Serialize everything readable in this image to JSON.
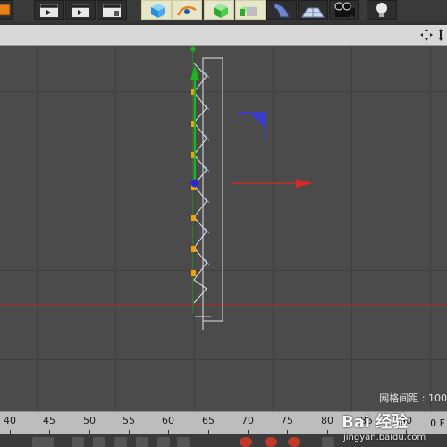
{
  "toolbar": {
    "buttons": [
      {
        "name": "cube-tool-icon",
        "active": false
      },
      {
        "name": "render-view-button",
        "active": false
      },
      {
        "name": "render-active-button",
        "active": false
      },
      {
        "name": "render-settings-button",
        "active": false
      },
      {
        "name": "cube-primitive-button",
        "active": true
      },
      {
        "name": "pen-spline-button",
        "active": true
      },
      {
        "name": "subdivision-button",
        "active": true
      },
      {
        "name": "array-generator-button",
        "active": true
      },
      {
        "name": "deformer-button",
        "active": false
      },
      {
        "name": "floor-plane-button",
        "active": false
      },
      {
        "name": "camera-button",
        "active": false
      },
      {
        "name": "light-button",
        "active": false
      }
    ]
  },
  "viewport": {
    "grid_spacing_label": "网格间距 : 100"
  },
  "timeline": {
    "ticks": [
      "40",
      "45",
      "50",
      "55",
      "60",
      "65",
      "70",
      "75",
      "80",
      "85",
      "90"
    ],
    "frame_field": "0 F"
  },
  "watermark": {
    "brand": "Bai 经验",
    "url": "jingyan.baidu.com"
  },
  "colors": {
    "x_axis": "#d42a2a",
    "y_axis": "#1fb51f",
    "z_axis": "#2a2ad4",
    "point": "#f2a010",
    "selection_box": "#e8e8e8"
  }
}
